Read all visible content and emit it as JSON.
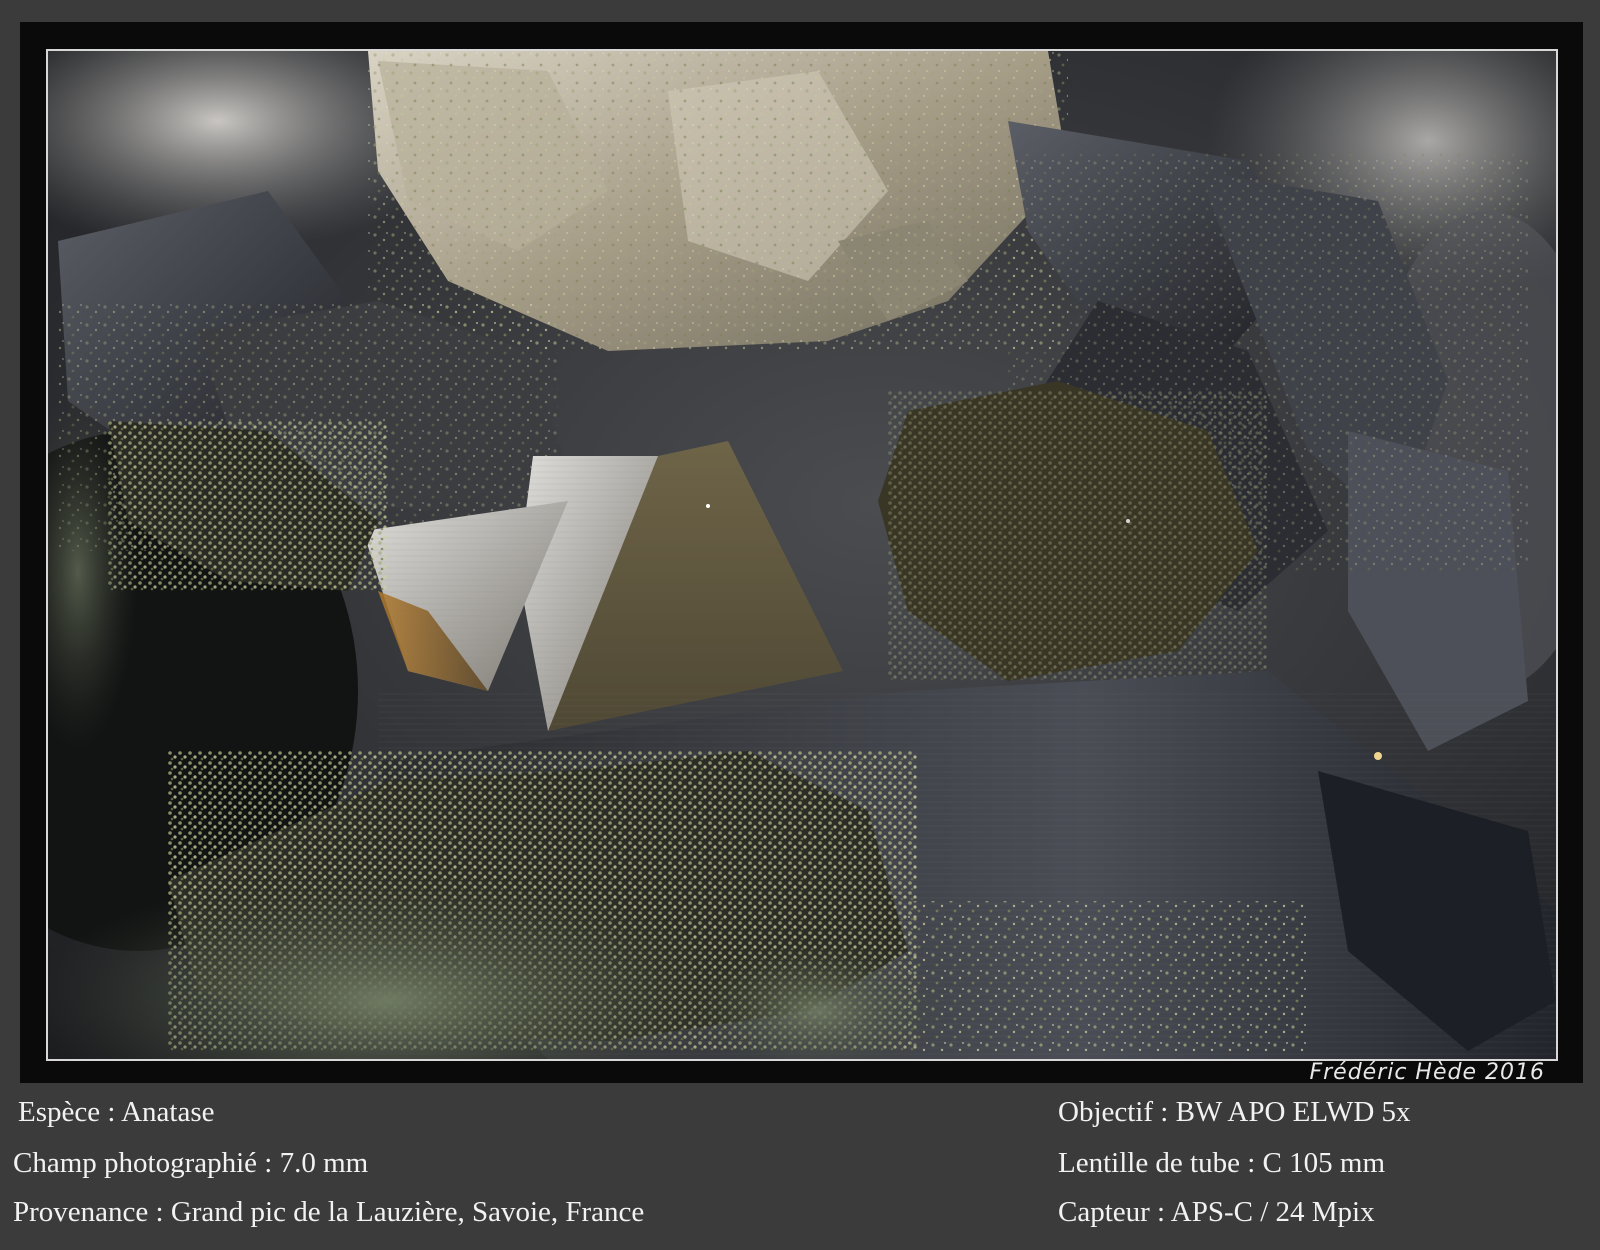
{
  "signature": "Frédéric Hède 2016",
  "captions": {
    "left": [
      "Espèce : Anatase",
      "Champ photographié : 7.0 mm",
      "Provenance : Grand pic de la Lauzière, Savoie, France"
    ],
    "right": [
      "Objectif : BW APO  ELWD 5x",
      "Lentille de tube : C 105 mm",
      "Capteur : APS-C / 24 Mpix"
    ]
  },
  "colors": {
    "background": "#3b3b3b",
    "frame": "#0a0a0a",
    "photo_border": "#d8d8d8",
    "text": "#f2f2f2"
  }
}
